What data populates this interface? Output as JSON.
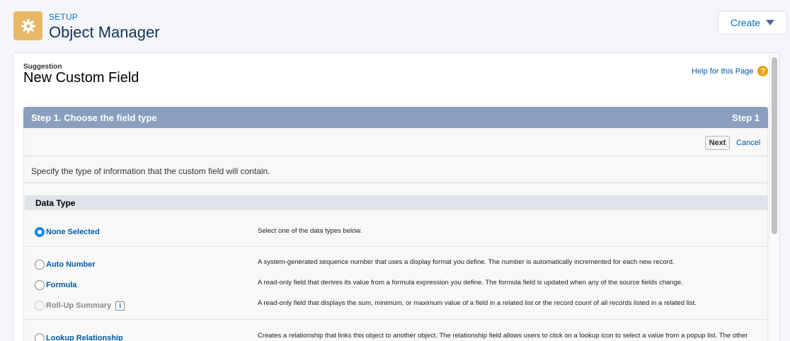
{
  "header": {
    "section_label": "SETUP",
    "page_title": "Object Manager",
    "create_label": "Create"
  },
  "page": {
    "suggestion_label": "Suggestion",
    "title": "New Custom Field",
    "help_link": "Help for this Page",
    "help_icon_glyph": "?"
  },
  "step": {
    "title": "Step 1. Choose the field type",
    "number": "Step 1",
    "next_label": "Next",
    "cancel_label": "Cancel",
    "instructions": "Specify the type of information that the custom field will contain."
  },
  "data_type": {
    "header": "Data Type",
    "options": [
      {
        "label": "None Selected",
        "description": "Select one of the data types below.",
        "selected": true,
        "enabled": true
      },
      {
        "label": "Auto Number",
        "description": "A system-generated sequence number that uses a display format you define. The number is automatically incremented for each new record.",
        "selected": false,
        "enabled": true
      },
      {
        "label": "Formula",
        "description": "A read-only field that derives its value from a formula expression you define. The formula field is updated when any of the source fields change.",
        "selected": false,
        "enabled": true
      },
      {
        "label": "Roll-Up Summary",
        "description": "A read-only field that displays the sum, minimum, or maximum value of a field in a related list or the record count of all records listed in a related list.",
        "selected": false,
        "enabled": false,
        "info_glyph": "i"
      },
      {
        "label": "Lookup Relationship",
        "description": "Creates a relationship that links this object to another object. The relationship field allows users to click on a lookup icon to select a value from a popup list. The other object is the source of the values in the list.",
        "selected": false,
        "enabled": true
      }
    ]
  },
  "colors": {
    "setup_icon_bg": "#e8b869",
    "link": "#015ba7",
    "step_bar": "#8a9ebe",
    "radio_selected": "#1589ee"
  }
}
